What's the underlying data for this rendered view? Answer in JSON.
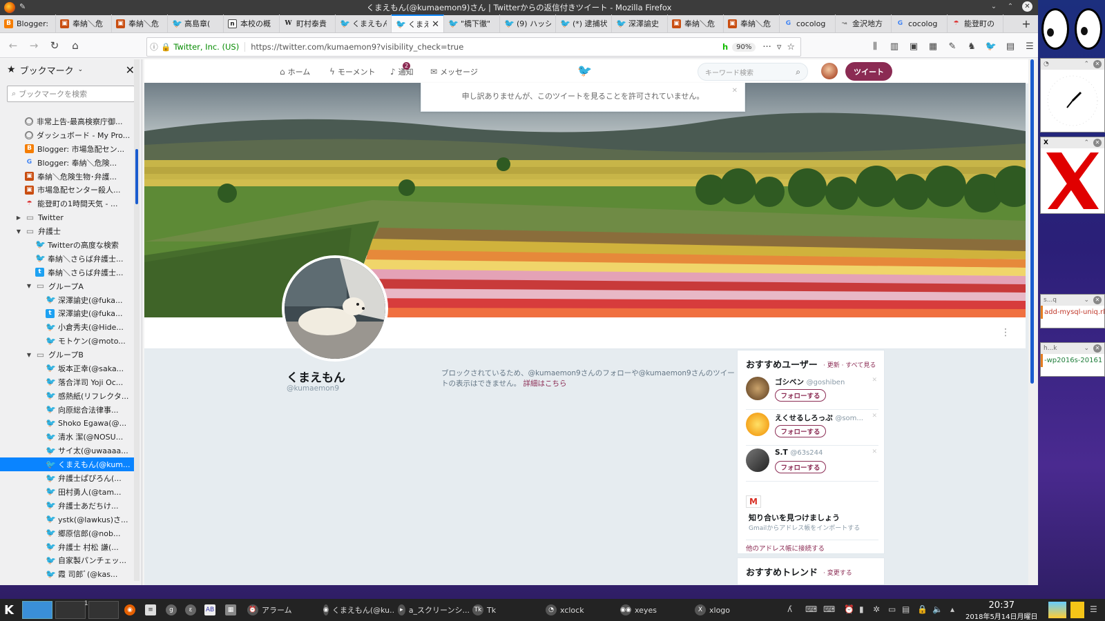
{
  "window": {
    "title": "くまえもん(@kumaemon9)さん | Twitterからの返信付きツイート - Mozilla Firefox"
  },
  "tabs": [
    {
      "label": "Blogger:",
      "icon": "blogger"
    },
    {
      "label": "奉納＼危",
      "icon": "generic"
    },
    {
      "label": "奉納＼危",
      "icon": "generic"
    },
    {
      "label": "高島章(",
      "icon": "twitter"
    },
    {
      "label": "本校の概",
      "icon": "notion"
    },
    {
      "label": "町村泰貴",
      "icon": "wiki"
    },
    {
      "label": "くまえもん",
      "icon": "twitter"
    },
    {
      "label": "くまえ",
      "icon": "twitter",
      "active": true
    },
    {
      "label": "\"橋下徹\"",
      "icon": "twitter"
    },
    {
      "label": "(9) ハッシ",
      "icon": "twitter"
    },
    {
      "label": "(*) 逮捕状",
      "icon": "twitter"
    },
    {
      "label": "深澤諭史",
      "icon": "twitter"
    },
    {
      "label": "奉納＼危",
      "icon": "generic"
    },
    {
      "label": "奉納＼危",
      "icon": "generic"
    },
    {
      "label": "cocolog",
      "icon": "google"
    },
    {
      "label": "金沢地方",
      "icon": "nettop"
    },
    {
      "label": "cocolog",
      "icon": "google"
    },
    {
      "label": "能登町の",
      "icon": "weather"
    }
  ],
  "navbar": {
    "identity": "Twitter, Inc. (US)",
    "url": "https://twitter.com/kumaemon9?visibility_check=true",
    "zoom": "90%",
    "h_badge": "h"
  },
  "sidebar": {
    "title": "ブックマーク",
    "search_placeholder": "ブックマークを検索",
    "items": [
      {
        "label": "非常上告-最高検察庁御...",
        "icon": "globe",
        "level": 0
      },
      {
        "label": "ダッシュボード - My Pro...",
        "icon": "globe",
        "level": 0
      },
      {
        "label": "Blogger: 市場急配セン...",
        "icon": "blogger",
        "level": 0
      },
      {
        "label": "Blogger: 奉納＼危険...",
        "icon": "google",
        "level": 0
      },
      {
        "label": "奉納＼危険生物･弁護...",
        "icon": "generic",
        "level": 0
      },
      {
        "label": "市場急配センター殺人...",
        "icon": "generic",
        "level": 0
      },
      {
        "label": "能登町の1時間天気 - ...",
        "icon": "weather",
        "level": 0
      },
      {
        "label": "Twitter",
        "icon": "folder",
        "level": 0,
        "arrow": "▶"
      },
      {
        "label": "弁護士",
        "icon": "folder",
        "level": 0,
        "arrow": "▼"
      },
      {
        "label": "Twitterの高度な検索",
        "icon": "twitter",
        "level": 1
      },
      {
        "label": "奉納＼さらば弁護士...",
        "icon": "twitter",
        "level": 1
      },
      {
        "label": "奉納＼さらば弁護士...",
        "icon": "bird2",
        "level": 1
      },
      {
        "label": "グループA",
        "icon": "folder",
        "level": 1,
        "arrow": "▼"
      },
      {
        "label": "深澤諭史(@fuka...",
        "icon": "twitter",
        "level": 2
      },
      {
        "label": "深澤諭史(@fuka...",
        "icon": "bird2",
        "level": 2
      },
      {
        "label": "小倉秀夫(@Hide...",
        "icon": "twitter",
        "level": 2
      },
      {
        "label": "モトケン(@moto...",
        "icon": "twitter",
        "level": 2
      },
      {
        "label": "グループB",
        "icon": "folder",
        "level": 1,
        "arrow": "▼"
      },
      {
        "label": "坂本正幸(@saka...",
        "icon": "twitter",
        "level": 2
      },
      {
        "label": "落合洋司 Yoji Oc...",
        "icon": "twitter",
        "level": 2
      },
      {
        "label": "感熱紙(リフレクタ...",
        "icon": "twitter",
        "level": 2
      },
      {
        "label": "向原総合法律事...",
        "icon": "twitter",
        "level": 2
      },
      {
        "label": "Shoko Egawa(@...",
        "icon": "twitter",
        "level": 2
      },
      {
        "label": "清水 潔(@NOSU...",
        "icon": "twitter",
        "level": 2
      },
      {
        "label": "サイ太(@uwaaaa...",
        "icon": "twitter",
        "level": 2
      },
      {
        "label": "くまえもん(@kum...",
        "icon": "twitter",
        "level": 2,
        "selected": true
      },
      {
        "label": "弁護士ぱぴろん(...",
        "icon": "twitter",
        "level": 2
      },
      {
        "label": "田村勇人(@tam...",
        "icon": "twitter",
        "level": 2
      },
      {
        "label": "弁護士あだちけ...",
        "icon": "twitter",
        "level": 2
      },
      {
        "label": "ystk(@lawkus)さ...",
        "icon": "twitter",
        "level": 2
      },
      {
        "label": "郷原信郎(@nob...",
        "icon": "twitter",
        "level": 2
      },
      {
        "label": "弁護士 村松 謙(...",
        "icon": "twitter",
        "level": 2
      },
      {
        "label": "自家製パンチェッ...",
        "icon": "twitter",
        "level": 2
      },
      {
        "label": "霞 司郎ﾞ(@kas...",
        "icon": "twitter",
        "level": 2
      }
    ]
  },
  "twitter": {
    "nav": {
      "home": "ホーム",
      "moments": "モーメント",
      "notifications": "通知",
      "messages": "メッセージ",
      "notif_count": "2"
    },
    "search_placeholder": "キーワード検索",
    "tweet_button": "ツイート",
    "alert": "申し訳ありませんが、このツイートを見ることを許可されていません。",
    "profile": {
      "name": "くまえもん",
      "handle": "@kumaemon9"
    },
    "blocked_text": "ブロックされているため、@kumaemon9さんのフォローや@kumaemon9さんのツイートの表示はできません。",
    "blocked_link": "詳細はこちら",
    "recommend": {
      "title": "おすすめユーザー",
      "links": "· 更新 · すべて見る",
      "users": [
        {
          "name": "ゴシベン",
          "handle": "@goshiben",
          "follow": "フォローする"
        },
        {
          "name": "えくせるしろっぷ",
          "handle": "@som...",
          "follow": "フォローする"
        },
        {
          "name": "S.T",
          "handle": "@63s244",
          "follow": "フォローする"
        }
      ],
      "gmail_title": "知り合いを見つけましょう",
      "gmail_sub": "Gmailからアドレス帳をインポートする",
      "other_link": "他のアドレス帳に接続する"
    },
    "trends": {
      "title": "おすすめトレンド",
      "link": "· 変更する"
    }
  },
  "desktop": {
    "w1_text": "add-mysql-uniq.rl",
    "w1_title": "s...q",
    "w2_text": "-wp2016s-20161",
    "w2_title": "h...k"
  },
  "taskbar": {
    "items": [
      {
        "label": "アラーム"
      },
      {
        "label": "くまえもん(@ku..."
      },
      {
        "label": "a_スクリーンシ..."
      },
      {
        "label": "Tk"
      },
      {
        "label": "xclock"
      },
      {
        "label": "xeyes"
      },
      {
        "label": "xlogo"
      }
    ],
    "desktop_num": "1",
    "time": "20:37",
    "date": "2018年5月14日月曜日"
  }
}
